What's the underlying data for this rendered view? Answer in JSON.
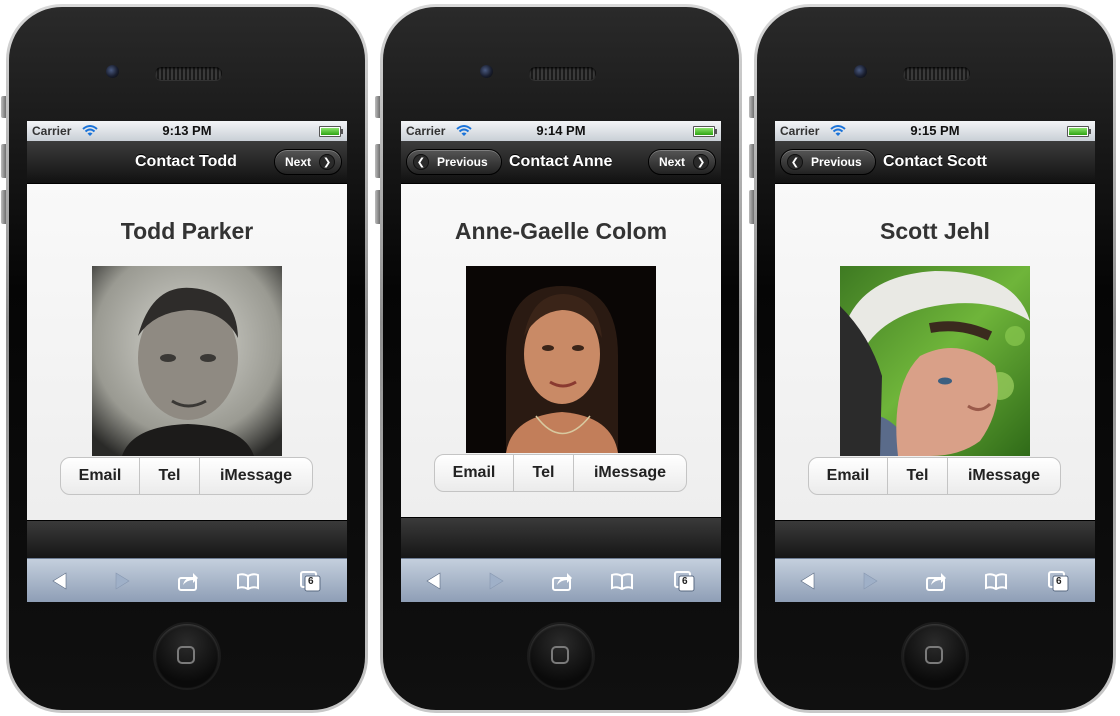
{
  "status_bar": {
    "carrier": "Carrier",
    "wifi_icon": "wifi-icon",
    "battery_icon": "battery-full-icon"
  },
  "phones": [
    {
      "time": "9:13 PM",
      "header_title": "Contact Todd",
      "prev_label": "",
      "next_label": "Next",
      "contact_name": "Todd Parker",
      "photo_desc_icon": "portrait-photo",
      "actions": [
        "Email",
        "Tel",
        "iMessage"
      ]
    },
    {
      "time": "9:14 PM",
      "header_title": "Contact Anne",
      "prev_label": "Previous",
      "next_label": "Next",
      "contact_name": "Anne-Gaelle Colom",
      "photo_desc_icon": "portrait-photo",
      "actions": [
        "Email",
        "Tel",
        "iMessage"
      ]
    },
    {
      "time": "9:15 PM",
      "header_title": "Contact Scott",
      "prev_label": "Previous",
      "next_label": "",
      "contact_name": "Scott Jehl",
      "photo_desc_icon": "portrait-photo",
      "actions": [
        "Email",
        "Tel",
        "iMessage"
      ]
    }
  ],
  "safari_toolbar": {
    "back_icon": "back-arrow-icon",
    "forward_icon": "forward-arrow-icon",
    "share_icon": "share-icon",
    "bookmarks_icon": "bookmarks-book-icon",
    "tabs_icon": "tabs-icon",
    "tab_count": "6"
  },
  "colors": {
    "header_dark": "#111111",
    "content_bg": "#f4f4f4",
    "safari_toolbar": "#a8b6ca",
    "battery_green": "#2fa514"
  }
}
